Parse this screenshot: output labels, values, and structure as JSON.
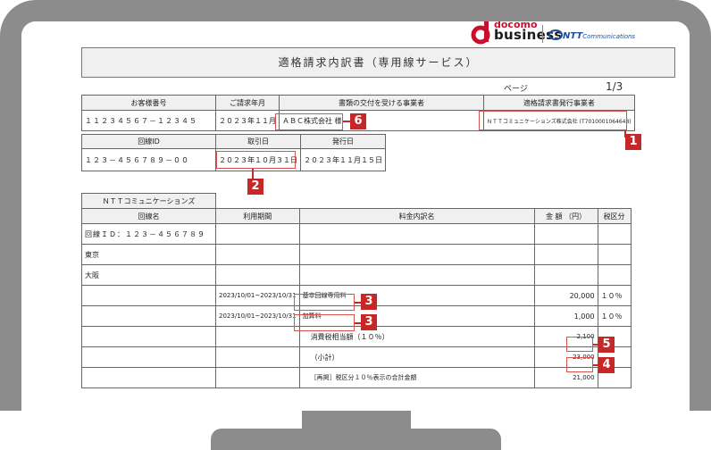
{
  "brand": {
    "docomo": "docomo",
    "business": "business",
    "ntt": "NTT",
    "ntt_sub": "Communications"
  },
  "doc": {
    "title": "適格請求内訳書（専用線サービス）",
    "page_label": "ページ",
    "page_value": "1/3"
  },
  "info_table": {
    "headers": [
      "お客様番号",
      "ご請求年月",
      "書類の交付を受ける事業者",
      "適格請求書発行事業者"
    ],
    "values": [
      "１１２３４５６７－１２３４５",
      "２０２３年１１月",
      "ＡＢＣ株式会社 様",
      "ＮＴＴコミュニケーションズ株式会社 (T7010001064648)"
    ]
  },
  "line_table": {
    "headers": [
      "回線ID",
      "取引日",
      "発行日"
    ],
    "values": [
      "１２３－４５６７８９－００",
      "２０２３年１０月３１日",
      "２０２３年１１月１５日"
    ]
  },
  "detail": {
    "company": "ＮＴＴコミュニケーションズ",
    "headers": [
      "回線名",
      "利用期間",
      "料金内訳名",
      "金 額 （円）",
      "税区分"
    ],
    "rows": [
      [
        "回線ＩＤ：１２３－４５６７８９",
        "",
        "",
        "",
        ""
      ],
      [
        "東京",
        "",
        "",
        "",
        ""
      ],
      [
        "大阪",
        "",
        "",
        "",
        ""
      ],
      [
        "",
        "2023/10/01~2023/10/31",
        "基本回線専用料",
        "20,000",
        "１０％"
      ],
      [
        "",
        "2023/10/01~2023/10/31",
        "加算料",
        "1,000",
        "１０％"
      ],
      [
        "",
        "",
        "消費税相当額（１０％）",
        "2,100",
        ""
      ],
      [
        "",
        "",
        "（小計）",
        "23,000",
        ""
      ],
      [
        "",
        "",
        "［再掲］税区分１０％表示の合計金額",
        "21,000",
        ""
      ]
    ]
  },
  "badges": [
    "1",
    "2",
    "3",
    "3",
    "4",
    "5",
    "6"
  ],
  "colors": {
    "accent": "#c62828",
    "frame": "#8c8c8c",
    "docomo_red": "#c8102e",
    "ntt_blue": "#1c4fa0"
  }
}
